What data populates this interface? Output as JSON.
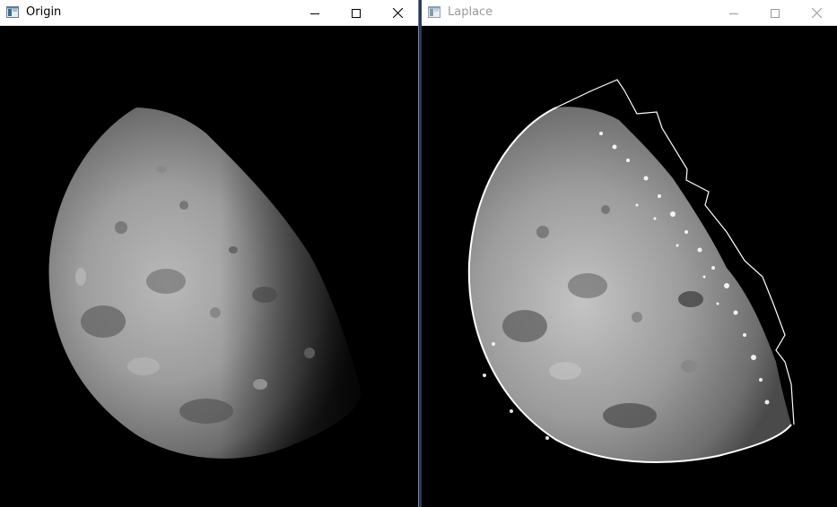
{
  "windows": [
    {
      "id": "origin",
      "title": "Origin",
      "active": true,
      "image": "moon-photograph",
      "controls": [
        "minimize-icon",
        "maximize-icon",
        "close-icon"
      ]
    },
    {
      "id": "laplace",
      "title": "Laplace",
      "active": false,
      "image": "moon-laplacian-sharpened",
      "controls": [
        "minimize-icon",
        "maximize-icon",
        "close-icon"
      ]
    }
  ],
  "colors": {
    "titlebar_bg": "#ffffff",
    "active_title": "#000000",
    "inactive_title": "#9a9a9a",
    "canvas_bg": "#000000",
    "window_border": "#6f86a6"
  }
}
